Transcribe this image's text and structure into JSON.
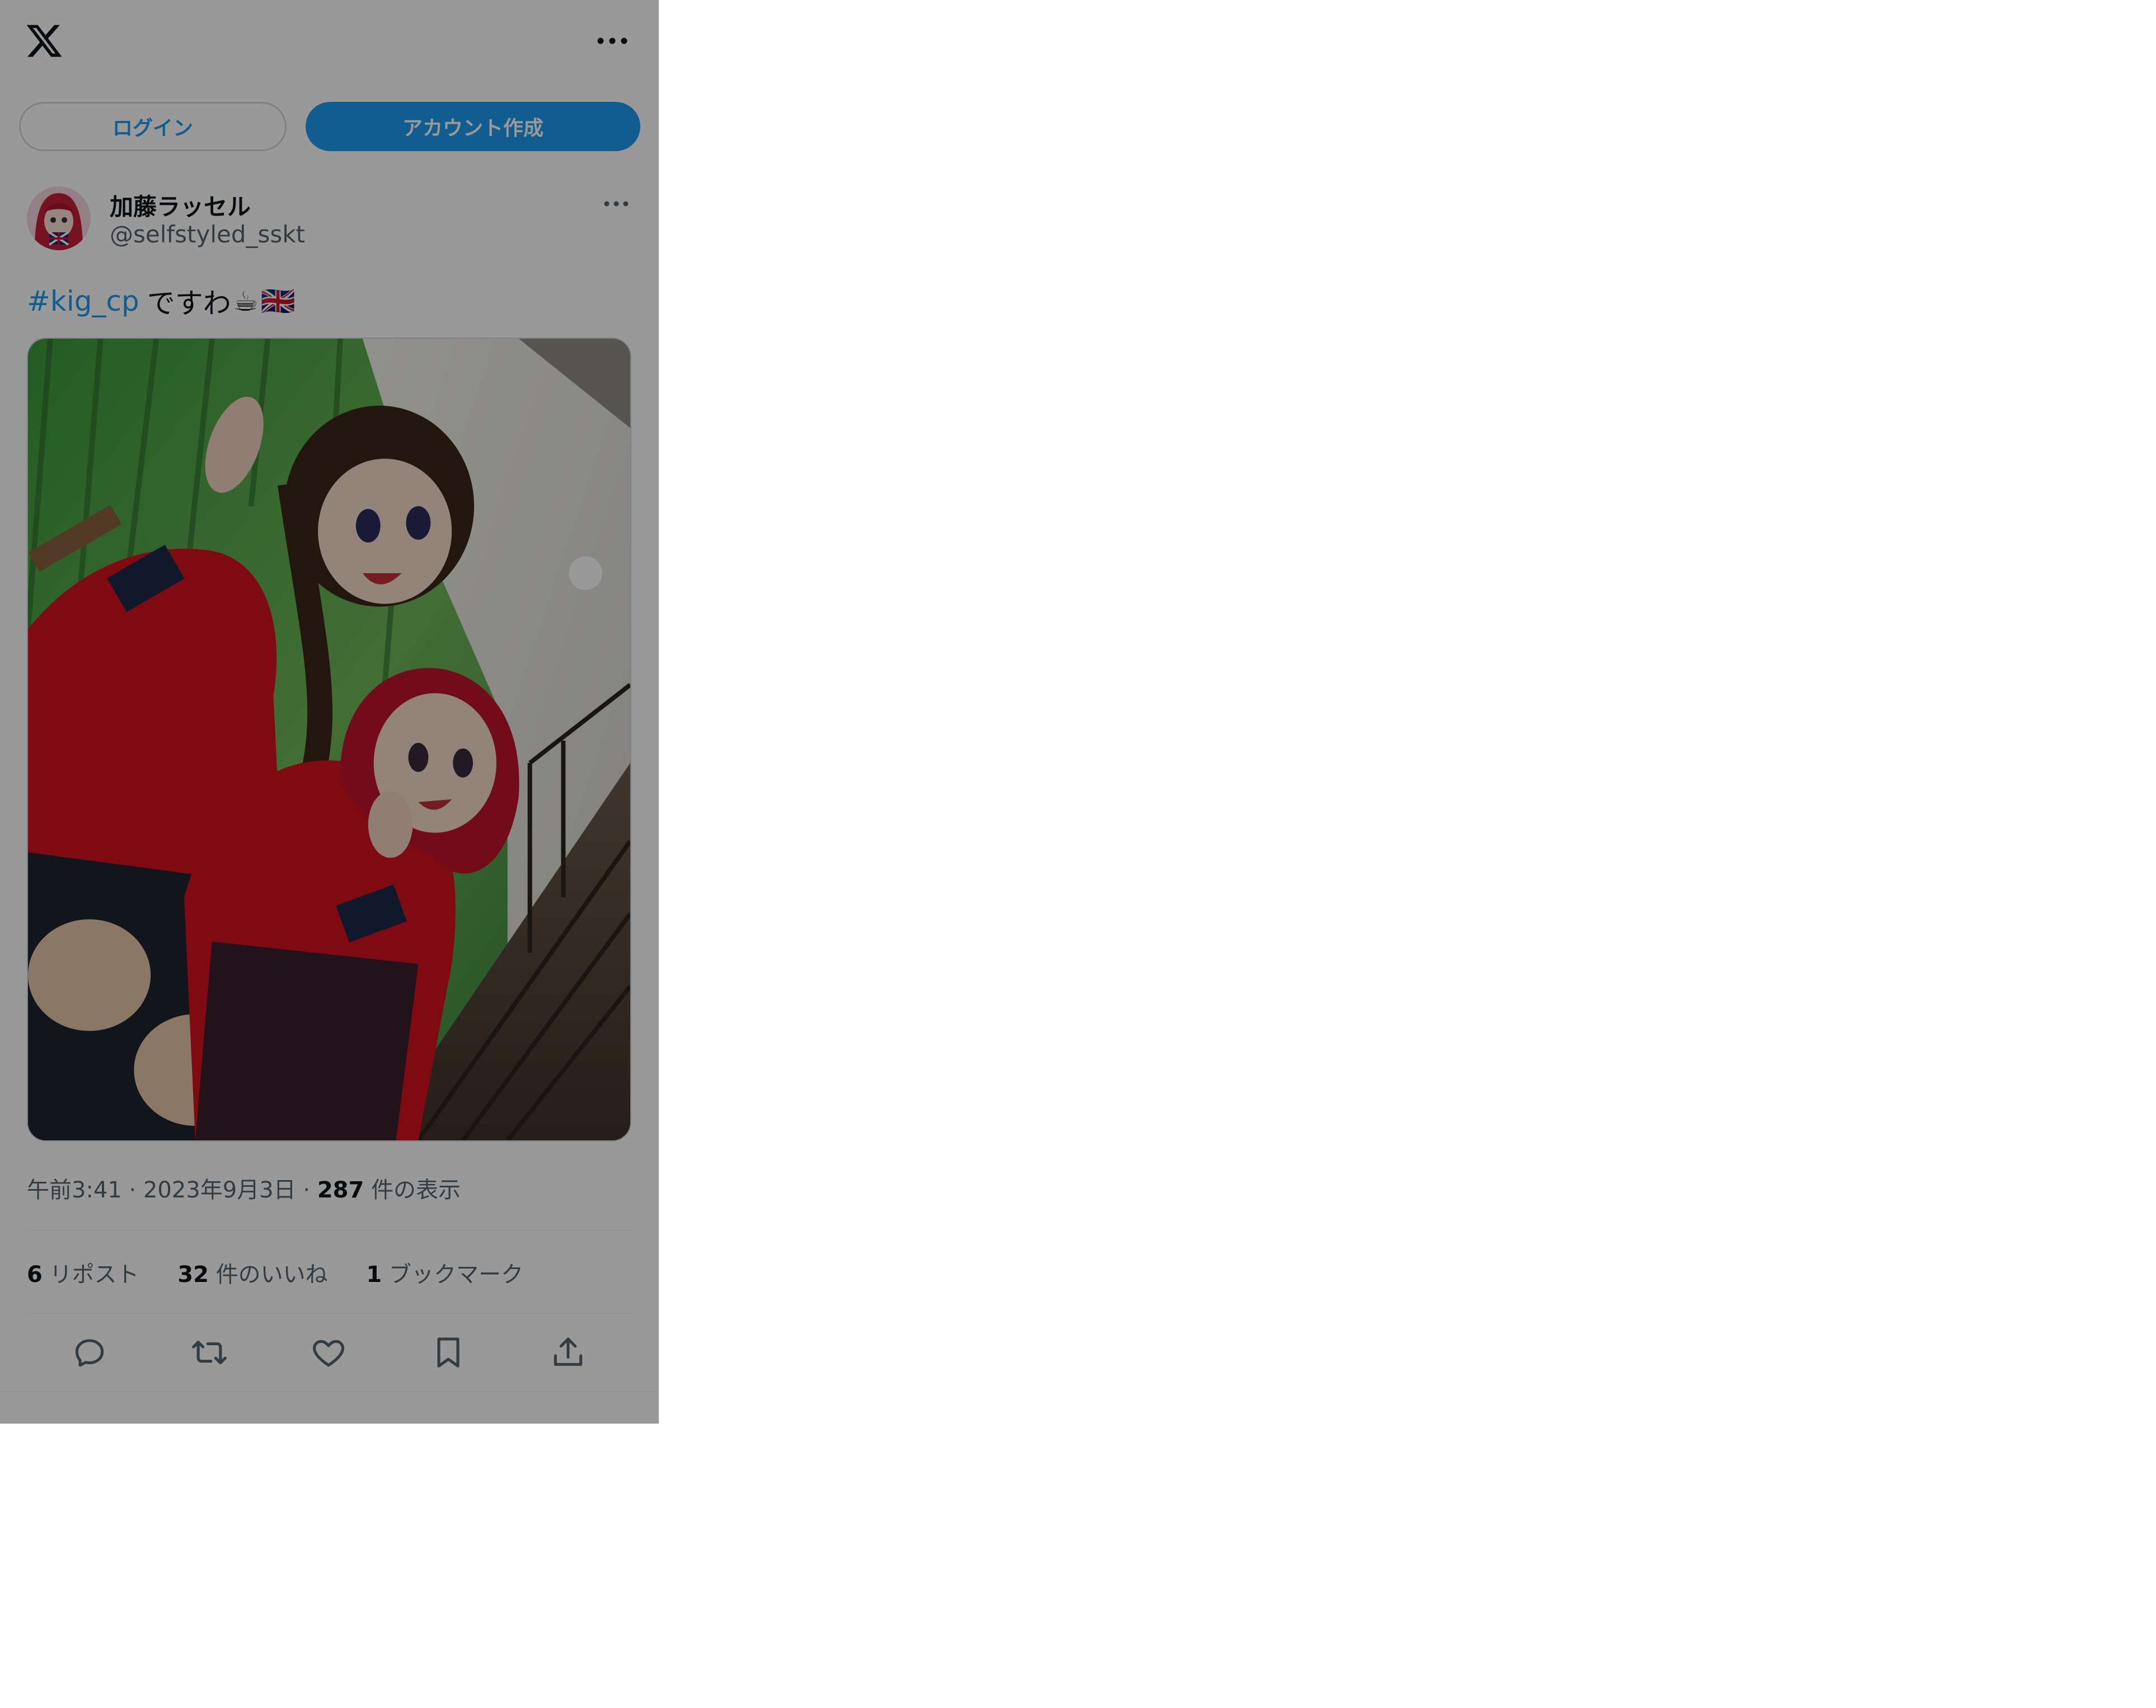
{
  "auth": {
    "login_label": "ログイン",
    "signup_label": "アカウント作成"
  },
  "author": {
    "display_name": "加藤ラッセル",
    "handle": "@selfstyled_sskt"
  },
  "tweet": {
    "hashtag": "#kig_cp",
    "text": "ですわ",
    "emojis": [
      "☕",
      "🇬🇧"
    ],
    "image_alt": "photo"
  },
  "meta": {
    "time": "午前3:41",
    "date": "2023年9月3日",
    "views_count": "287",
    "views_label": "件の表示"
  },
  "stats": {
    "reposts_count": "6",
    "reposts_label": "リポスト",
    "likes_count": "32",
    "likes_label": "件のいいね",
    "bookmarks_count": "1",
    "bookmarks_label": "ブックマーク"
  },
  "icons": [
    "x-logo-icon",
    "more-icon",
    "reply-icon",
    "repost-icon",
    "like-icon",
    "bookmark-icon",
    "share-icon"
  ],
  "colors": {
    "accent": "#1d9bf0",
    "text": "#0f1419",
    "secondary": "#536471",
    "overlay": "rgba(0,0,0,0.40)"
  }
}
